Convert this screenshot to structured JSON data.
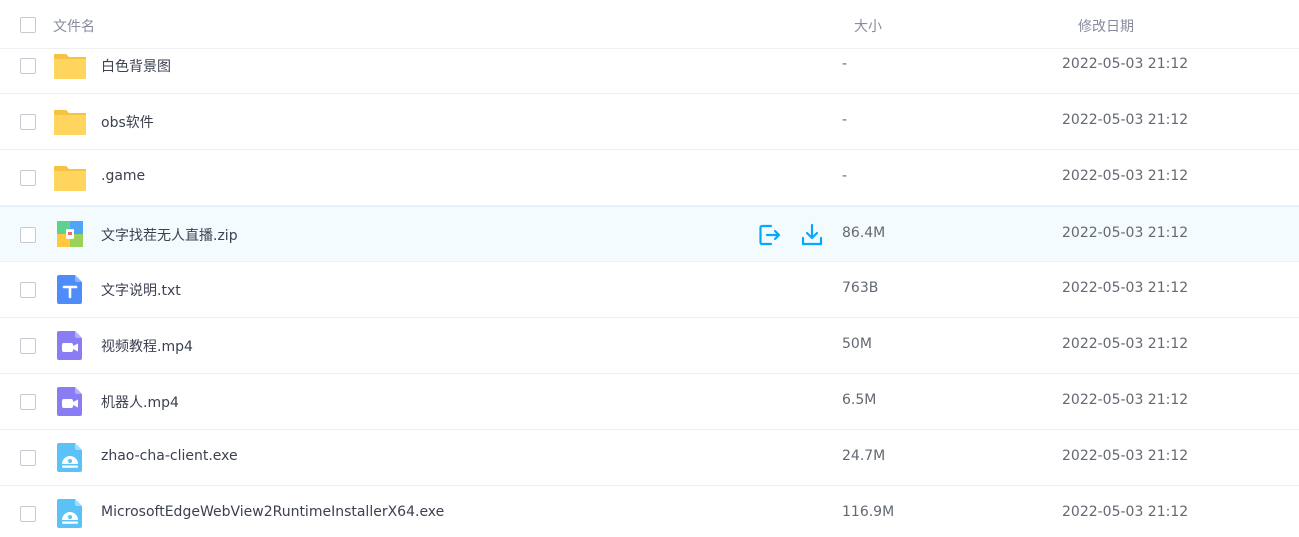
{
  "header": {
    "name_label": "文件名",
    "size_label": "大小",
    "date_label": "修改日期"
  },
  "colors": {
    "accent": "#06a7ff",
    "folder": "#ffd55d",
    "text_file": "#4e8df9",
    "video_file": "#8a7cf3",
    "exe_file": "#5bc2f7"
  },
  "files": [
    {
      "name": "白色背景图",
      "size": "-",
      "date": "2022-05-03 21:12",
      "icon": "folder-icon"
    },
    {
      "name": "obs软件",
      "size": "-",
      "date": "2022-05-03 21:12",
      "icon": "folder-icon"
    },
    {
      "name": ".game",
      "size": "-",
      "date": "2022-05-03 21:12",
      "icon": "folder-icon"
    },
    {
      "name": "文字找茬无人直播.zip",
      "size": "86.4M",
      "date": "2022-05-03 21:12",
      "icon": "zip-file-icon"
    },
    {
      "name": "文字说明.txt",
      "size": "763B",
      "date": "2022-05-03 21:12",
      "icon": "text-file-icon"
    },
    {
      "name": "视频教程.mp4",
      "size": "50M",
      "date": "2022-05-03 21:12",
      "icon": "video-file-icon"
    },
    {
      "name": "机器人.mp4",
      "size": "6.5M",
      "date": "2022-05-03 21:12",
      "icon": "video-file-icon"
    },
    {
      "name": "zhao-cha-client.exe",
      "size": "24.7M",
      "date": "2022-05-03 21:12",
      "icon": "exe-file-icon"
    },
    {
      "name": "MicrosoftEdgeWebView2RuntimeInstallerX64.exe",
      "size": "116.9M",
      "date": "2022-05-03 21:12",
      "icon": "exe-file-icon"
    }
  ],
  "row_actions": {
    "share_icon": "share-icon",
    "download_icon": "download-icon"
  }
}
